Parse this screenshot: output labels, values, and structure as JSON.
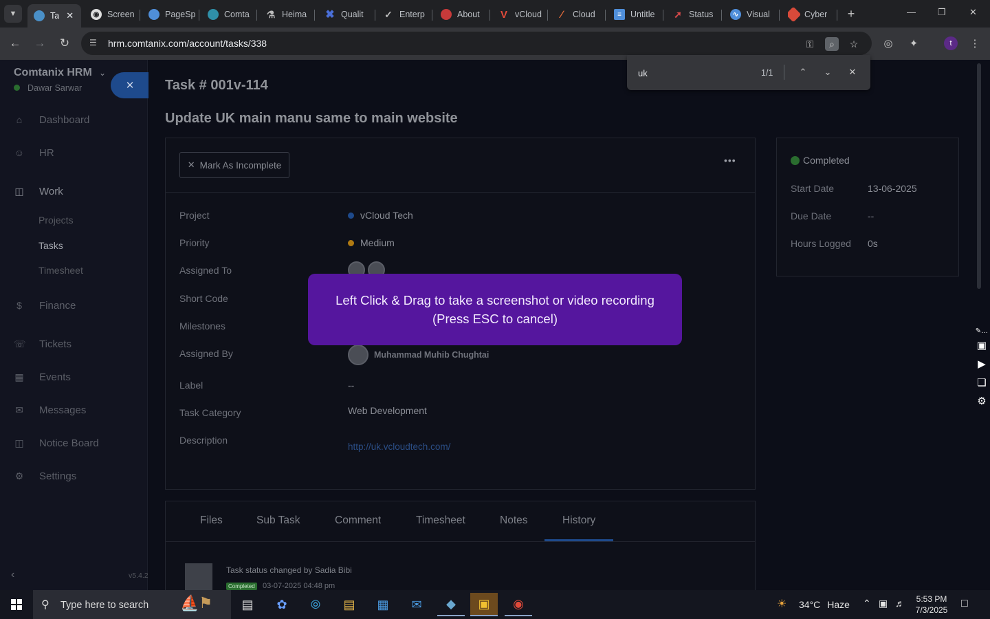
{
  "browser": {
    "tabs": [
      {
        "title": "Ta",
        "icon": "chrome-icon",
        "active": true,
        "color": "#4a90c8"
      },
      {
        "title": "Screen",
        "icon": "screenshot-icon",
        "color": "#dddddd"
      },
      {
        "title": "PageSp",
        "icon": "pagespeed-icon",
        "color": "#4f8ed9"
      },
      {
        "title": "Comta",
        "icon": "comtanix-icon",
        "color": "#2f8fa8"
      },
      {
        "title": "Heima",
        "icon": "heimat-icon",
        "color": "#bcbcbc"
      },
      {
        "title": "Qualit",
        "icon": "quality-x-icon",
        "color": "#4a6fd8"
      },
      {
        "title": "Enterp",
        "icon": "enterprise-icon",
        "color": "#bcbcbc"
      },
      {
        "title": "About",
        "icon": "about-icon",
        "color": "#c83a3a"
      },
      {
        "title": "vCloud",
        "icon": "vcloud-icon",
        "color": "#e34b3a"
      },
      {
        "title": "Cloud",
        "icon": "cloud-icon",
        "color": "#e06a3a"
      },
      {
        "title": "Untitle",
        "icon": "docs-icon",
        "color": "#4f8ed9"
      },
      {
        "title": "Status",
        "icon": "status-icon",
        "color": "#d84a4a"
      },
      {
        "title": "Visual",
        "icon": "visual-icon",
        "color": "#4f8ed9"
      },
      {
        "title": "Cyber",
        "icon": "cyber-icon",
        "color": "#d84a3a"
      }
    ],
    "url": "hrm.comtanix.com/account/tasks/338",
    "profile_initial": "t",
    "find": {
      "query": "uk",
      "count": "1/1"
    }
  },
  "sidebar": {
    "brand": "Comtanix HRM",
    "user": "Dawar Sarwar",
    "menu": {
      "dashboard": "Dashboard",
      "hr": "HR",
      "work": "Work",
      "projects": "Projects",
      "tasks": "Tasks",
      "timesheet": "Timesheet",
      "finance": "Finance",
      "tickets": "Tickets",
      "events": "Events",
      "messages": "Messages",
      "notice_board": "Notice Board",
      "settings": "Settings"
    },
    "version": "v5.4.2"
  },
  "task": {
    "number": "Task # 001v-114",
    "title": "Update UK main manu same to main website",
    "mark_incomplete": "Mark As Incomplete",
    "more": "•••",
    "labels": {
      "project": "Project",
      "priority": "Priority",
      "assigned_to": "Assigned To",
      "short_code": "Short Code",
      "milestones": "Milestones",
      "assigned_by": "Assigned By",
      "label": "Label",
      "task_category": "Task Category",
      "description": "Description"
    },
    "values": {
      "project": "vCloud Tech",
      "project_color": "#1e4a8c",
      "priority": "Medium",
      "priority_color": "#b07a12",
      "assigned_by": "Muhammad Muhib Chughtai",
      "label": "--",
      "task_category": "Web Development",
      "description_link": "http://uk.vcloudtech.com/"
    }
  },
  "status": {
    "state": "Completed",
    "start_label": "Start Date",
    "start_value": "13-06-2025",
    "due_label": "Due Date",
    "due_value": "--",
    "hours_label": "Hours Logged",
    "hours_value": "0s"
  },
  "tabs": {
    "files": "Files",
    "sub_task": "Sub Task",
    "comment": "Comment",
    "timesheet": "Timesheet",
    "notes": "Notes",
    "history": "History",
    "active": "History"
  },
  "history": {
    "text": "Task status changed by Sadia Bibi",
    "badge": "Completed",
    "time": "03-07-2025 04:48 pm"
  },
  "overlay": {
    "line1": "Left Click & Drag to take a screenshot or video recording",
    "line2": "(Press ESC to cancel)"
  },
  "taskbar": {
    "search_placeholder": "Type here to search",
    "temperature": "34°C",
    "condition": "Haze",
    "time": "5:53 PM",
    "date": "7/3/2025"
  }
}
